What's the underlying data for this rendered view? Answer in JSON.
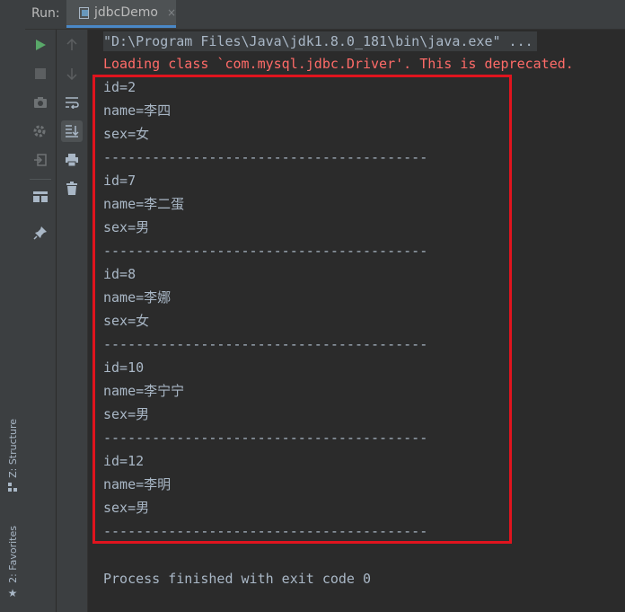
{
  "run_header": {
    "label": "Run:",
    "tab_title": "jdbcDemo",
    "tab_close": "×"
  },
  "left_stripe": {
    "structure_label": "Z: Structure",
    "favorites_label": "2: Favorites"
  },
  "console": {
    "command_line": "\"D:\\Program Files\\Java\\jdk1.8.0_181\\bin\\java.exe\" ...",
    "warning_line": "Loading class `com.mysql.jdbc.Driver'. This is deprecated.",
    "records": [
      {
        "id": "id=2",
        "name": "name=李四",
        "sex": "sex=女",
        "sep": "----------------------------------------"
      },
      {
        "id": "id=7",
        "name": "name=李二蛋",
        "sex": "sex=男",
        "sep": "----------------------------------------"
      },
      {
        "id": "id=8",
        "name": "name=李娜",
        "sex": "sex=女",
        "sep": "----------------------------------------"
      },
      {
        "id": "id=10",
        "name": "name=李宁宁",
        "sex": "sex=男",
        "sep": "----------------------------------------"
      },
      {
        "id": "id=12",
        "name": "name=李明",
        "sex": "sex=男",
        "sep": "----------------------------------------"
      }
    ],
    "exit_line": "Process finished with exit code 0"
  },
  "colors": {
    "accent": "#4a88c7",
    "warning": "#ff6b68",
    "run_green": "#59a869",
    "highlight": "#e0141e"
  }
}
